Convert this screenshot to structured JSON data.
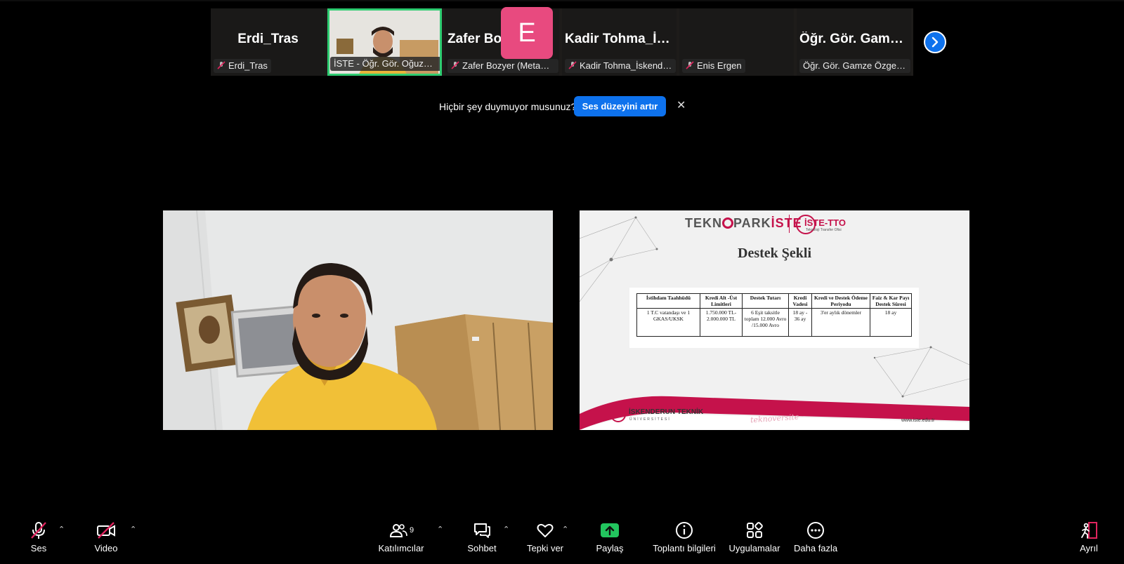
{
  "participants": [
    {
      "display_name": "Erdi_Tras",
      "tag": "Erdi_Tras",
      "muted": true
    },
    {
      "display_name": "",
      "tag": "İSTE - Öğr. Gör. Oğuzhan ...",
      "muted": true,
      "speaking": true
    },
    {
      "display_name": "Zafer Bozyer (M...",
      "tag": "Zafer Bozyer (MetaThi...",
      "muted": true
    },
    {
      "display_name": "Kadir Tohma_İs...",
      "tag": "Kadir Tohma_İskender...",
      "muted": true
    },
    {
      "display_name": "",
      "avatar_letter": "E",
      "tag": "Enis Ergen",
      "muted": true
    },
    {
      "display_name": "Öğr. Gör. Gamze...",
      "tag": "Öğr. Gör. Gamze Özge GÜ...",
      "muted": false
    }
  ],
  "notice": {
    "text": "Hiçbir şey duymuyor musunuz?",
    "button": "Ses düzeyini artır",
    "close": "✕"
  },
  "slide": {
    "brand_left": "TEKN",
    "brand_mid": "PARK",
    "brand_iste": "İSTE",
    "brand_tto": "İSTE-TTO",
    "brand_tto_sub": "Teknoloji Transfer Ofisi",
    "title": "Destek Şekli",
    "table_headers": [
      "İstihdam Taahhüdü",
      "Kredi Alt -Üst Limitleri",
      "Destek Tutarı",
      "Kredi Vadesi",
      "Kredi ve Destek Ödeme Periyodu",
      "Faiz & Kar Payı Destek Süresi"
    ],
    "table_row": [
      "1 T.C vatandaşı ve 1 GKAS/UKSK",
      "1.750.000 TL-2.000.000 TL",
      "6 Eşit taksitle toplam 12.000 Avro /15.000 Avro",
      "18 ay - 36 ay",
      "3'er aylık dönemler",
      "18 ay"
    ],
    "footer_uni": "İSKENDERUN TEKNİK",
    "footer_uni_sub": "ÜNİVERSİTESİ",
    "footer_script": "teknoversite",
    "footer_url": "www.iste.edu.tr"
  },
  "toolbar": {
    "audio": "Ses",
    "video": "Video",
    "participants": "Katılımcılar",
    "participants_count": "9",
    "chat": "Sohbet",
    "react": "Tepki ver",
    "share": "Paylaş",
    "info": "Toplantı bilgileri",
    "apps": "Uygulamalar",
    "more": "Daha fazla",
    "leave": "Ayrıl"
  },
  "colors": {
    "accent": "#0e72ed",
    "speaking": "#2ecc71",
    "share": "#22c55e",
    "avatar": "#e84a7f",
    "muted": "#e0245e"
  }
}
